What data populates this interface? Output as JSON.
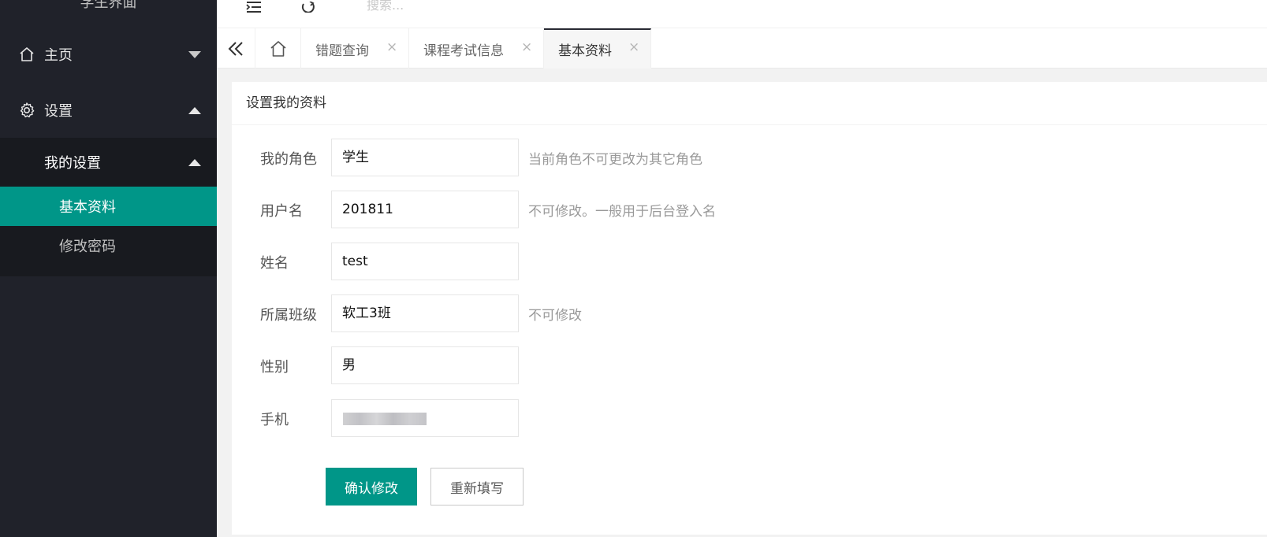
{
  "sidebar": {
    "title": "学生界面",
    "items": [
      {
        "label": "主页"
      },
      {
        "label": "设置"
      }
    ],
    "submenu": {
      "label": "我的设置",
      "items": [
        {
          "label": "基本资料"
        },
        {
          "label": "修改密码"
        }
      ]
    }
  },
  "header": {
    "search_placeholder": "搜索..."
  },
  "tabs": [
    {
      "label": "错题查询",
      "close": "×"
    },
    {
      "label": "课程考试信息",
      "close": "×"
    },
    {
      "label": "基本资料",
      "close": "×"
    }
  ],
  "card": {
    "title": "设置我的资料"
  },
  "form": {
    "fields": [
      {
        "label": "我的角色",
        "value": "学生",
        "hint": "当前角色不可更改为其它角色"
      },
      {
        "label": "用户名",
        "value": "201811",
        "hint": "不可修改。一般用于后台登入名"
      },
      {
        "label": "姓名",
        "value": "test",
        "hint": ""
      },
      {
        "label": "所属班级",
        "value": "软工3班",
        "hint": "不可修改"
      },
      {
        "label": "性别",
        "value": "男",
        "hint": ""
      },
      {
        "label": "手机",
        "value": "",
        "hint": ""
      }
    ],
    "submit_label": "确认修改",
    "reset_label": "重新填写"
  },
  "colors": {
    "sidebar_bg": "#20222a",
    "accent": "#009688"
  }
}
